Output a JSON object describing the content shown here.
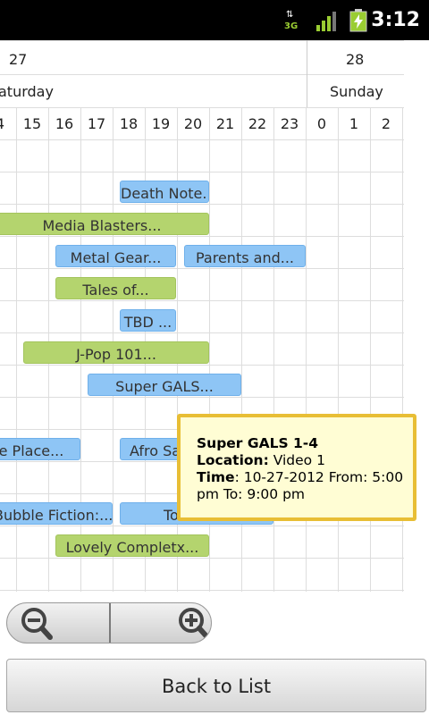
{
  "status_bar": {
    "time": "3:12",
    "network_label": "3G",
    "icons": [
      "data-arrows-icon",
      "signal-icon",
      "battery-charging-icon"
    ]
  },
  "schedule": {
    "dates": [
      "27",
      "28"
    ],
    "days": [
      "aturday",
      "Sunday"
    ],
    "hours": [
      "4",
      "15",
      "16",
      "17",
      "18",
      "19",
      "20",
      "21",
      "22",
      "23",
      "0",
      "1",
      "2"
    ],
    "events": [
      {
        "label": "Death Note...",
        "color": "blue"
      },
      {
        "label": "Media Blasters...",
        "color": "green"
      },
      {
        "label": "Metal Gear...",
        "color": "blue"
      },
      {
        "label": "Parents and...",
        "color": "blue"
      },
      {
        "label": "Tales of...",
        "color": "green"
      },
      {
        "label": "TBD ...",
        "color": "blue"
      },
      {
        "label": "J-Pop 101...",
        "color": "green"
      },
      {
        "label": "Super GALS...",
        "color": "blue"
      },
      {
        "label": "e Place...",
        "color": "blue"
      },
      {
        "label": "Afro Sa",
        "color": "blue"
      },
      {
        "label": "Bubble Fiction:...",
        "color": "blue"
      },
      {
        "label": "To",
        "color": "blue"
      },
      {
        "label": "Lovely Completx...",
        "color": "green"
      }
    ]
  },
  "popup": {
    "title": "Super GALS 1-4",
    "location_label": "Location:",
    "location_value": " Video 1",
    "time_label": "Time",
    "time_value": ": 10-27-2012 From: 5:00 pm To: 9:00 pm"
  },
  "zoom": {
    "zoom_out_icon": "zoom-out-icon",
    "zoom_in_icon": "zoom-in-icon"
  },
  "back_button": {
    "label": "Back to List"
  },
  "colors": {
    "event_blue": "#8ec5f5",
    "event_green": "#b4d46e",
    "popup_border": "#e8be35",
    "popup_bg": "#fffdd4"
  }
}
